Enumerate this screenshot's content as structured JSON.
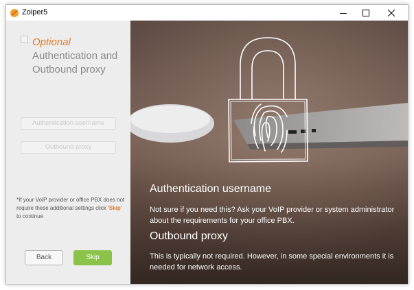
{
  "window": {
    "title": "Zoiper5"
  },
  "left": {
    "optional_label": "Optional",
    "heading_line1": "Authentication and",
    "heading_line2": "Outbound proxy",
    "auth_username_placeholder": "Authentication username",
    "outbound_proxy_placeholder": "Outbound proxy",
    "note_before": "*If your VoIP provider or office PBX does not require these additional settings click ",
    "note_skip": "'Skip'",
    "note_after": " to continue",
    "back_label": "Back",
    "skip_label": "Skip"
  },
  "right": {
    "auth_title": "Authentication username",
    "auth_text": "Not sure if you need this? Ask your VoIP provider or system administrator about the requirements for your office PBX.",
    "proxy_title": "Outbound proxy",
    "proxy_text": "This is typically not required. However, in some special environments it is needed for network access."
  },
  "colors": {
    "accent_orange": "#e07b2a",
    "skip_green": "#8bc34a"
  },
  "icons": [
    "zoiper-app-icon",
    "minimize-icon",
    "maximize-icon",
    "close-icon",
    "padlock-fingerprint-icon"
  ]
}
